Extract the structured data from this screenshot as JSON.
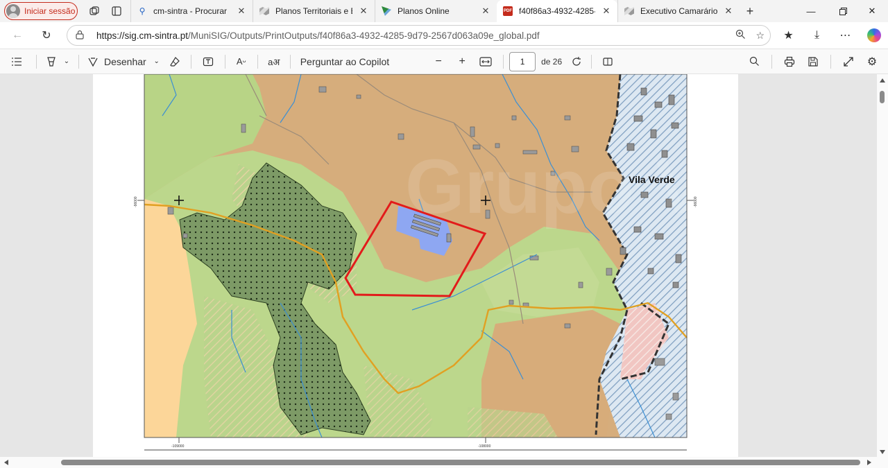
{
  "browser": {
    "profile_label": "Iniciar sessão",
    "tabs": [
      {
        "title": "cm-sintra - Procurar",
        "favicon": "search-icon"
      },
      {
        "title": "Planos Territoriais e Estr",
        "favicon": "map-icon"
      },
      {
        "title": "Planos Online",
        "favicon": "plans-icon"
      },
      {
        "title": "f40f86a3-4932-4285-9d",
        "favicon": "pdf-icon",
        "active": true
      },
      {
        "title": "Executivo Camarário",
        "favicon": "map-icon"
      }
    ]
  },
  "address": {
    "url_host": "https://sig.cm-sintra.pt",
    "url_path": "/MuniSIG/Outputs/PrintOutputs/f40f86a3-4932-4285-9d79-2567d063a09e_global.pdf"
  },
  "pdf_toolbar": {
    "draw_label": "Desenhar",
    "copilot_label": "Perguntar ao Copilot",
    "page_current": "1",
    "page_total": "de 26"
  },
  "map": {
    "place_label": "Vila Verde",
    "watermark": "Grupo Valor",
    "coord_left_vertical": "-96000",
    "coord_right_vertical": "-96000",
    "coord_bottom_left": "-109000",
    "coord_bottom_right": "-108000"
  },
  "colors": {
    "accent_red": "#c42b1c",
    "terrain_tan": "#d9b07f",
    "terrain_green": "#b9d78a",
    "forest_green": "#7a9a64",
    "urban_blue": "#c7d9ea",
    "boundary_red": "#e21b1b",
    "road_orange": "#e0a020"
  }
}
